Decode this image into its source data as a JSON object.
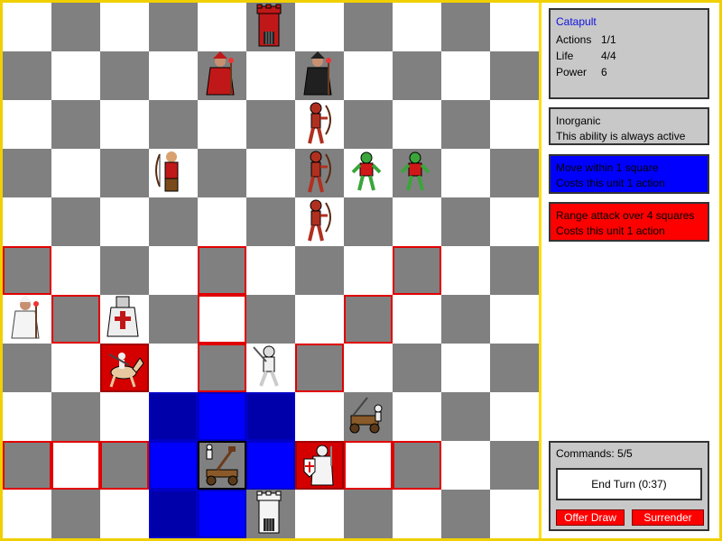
{
  "info": {
    "unit_name": "Catapult",
    "actions_label": "Actions",
    "actions_value": "1/1",
    "life_label": "Life",
    "life_value": "4/4",
    "power_label": "Power",
    "power_value": "6"
  },
  "abilities": [
    {
      "title": "Inorganic",
      "desc": "This ability is always active"
    },
    {
      "title": "Move within 1 square",
      "desc": "Costs this unit 1 action"
    },
    {
      "title": "Range attack over 4 squares",
      "desc": "Costs this unit 1 action"
    }
  ],
  "commands": {
    "label": "Commands: 5/5",
    "end_turn": "End Turn (0:37)",
    "offer_draw": "Offer Draw",
    "surrender": "Surrender"
  },
  "colors": {
    "board_dark": "#808080",
    "board_light": "#ffffff",
    "move_highlight": "#0000ff",
    "attack_highlight": "#ff0000",
    "frame": "#ffdd00"
  },
  "board": {
    "rows": 11,
    "cols": 11,
    "red_outline": [
      [
        5,
        0
      ],
      [
        5,
        4
      ],
      [
        5,
        8
      ],
      [
        6,
        1
      ],
      [
        6,
        4
      ],
      [
        6,
        7
      ],
      [
        7,
        4
      ],
      [
        7,
        6
      ],
      [
        9,
        0
      ],
      [
        9,
        1
      ],
      [
        9,
        2
      ],
      [
        9,
        7
      ],
      [
        9,
        8
      ]
    ],
    "blue": [
      [
        8,
        3
      ],
      [
        8,
        4
      ],
      [
        8,
        5
      ],
      [
        9,
        3
      ],
      [
        9,
        5
      ],
      [
        10,
        3
      ],
      [
        10,
        4
      ]
    ],
    "red_fill": [
      [
        7,
        2
      ],
      [
        9,
        6
      ]
    ],
    "selected": [
      [
        9,
        4
      ]
    ],
    "pieces": [
      {
        "row": 0,
        "col": 5,
        "type": "tower",
        "team": "red"
      },
      {
        "row": 1,
        "col": 4,
        "type": "wizard",
        "team": "red"
      },
      {
        "row": 1,
        "col": 6,
        "type": "wizard",
        "team": "black"
      },
      {
        "row": 2,
        "col": 6,
        "type": "skeleton-archer",
        "team": "red"
      },
      {
        "row": 3,
        "col": 3,
        "type": "archer",
        "team": "red"
      },
      {
        "row": 3,
        "col": 6,
        "type": "skeleton-archer",
        "team": "red"
      },
      {
        "row": 3,
        "col": 7,
        "type": "zombie",
        "team": "green"
      },
      {
        "row": 3,
        "col": 8,
        "type": "zombie",
        "team": "green"
      },
      {
        "row": 4,
        "col": 6,
        "type": "skeleton-archer",
        "team": "red"
      },
      {
        "row": 6,
        "col": 0,
        "type": "wizard",
        "team": "white"
      },
      {
        "row": 6,
        "col": 2,
        "type": "knight",
        "team": "white"
      },
      {
        "row": 7,
        "col": 2,
        "type": "cavalry",
        "team": "white"
      },
      {
        "row": 7,
        "col": 5,
        "type": "swordsman",
        "team": "white"
      },
      {
        "row": 8,
        "col": 7,
        "type": "ballista",
        "team": "white"
      },
      {
        "row": 9,
        "col": 4,
        "type": "catapult",
        "team": "white"
      },
      {
        "row": 9,
        "col": 6,
        "type": "paladin",
        "team": "white"
      },
      {
        "row": 10,
        "col": 5,
        "type": "tower",
        "team": "white"
      }
    ]
  }
}
